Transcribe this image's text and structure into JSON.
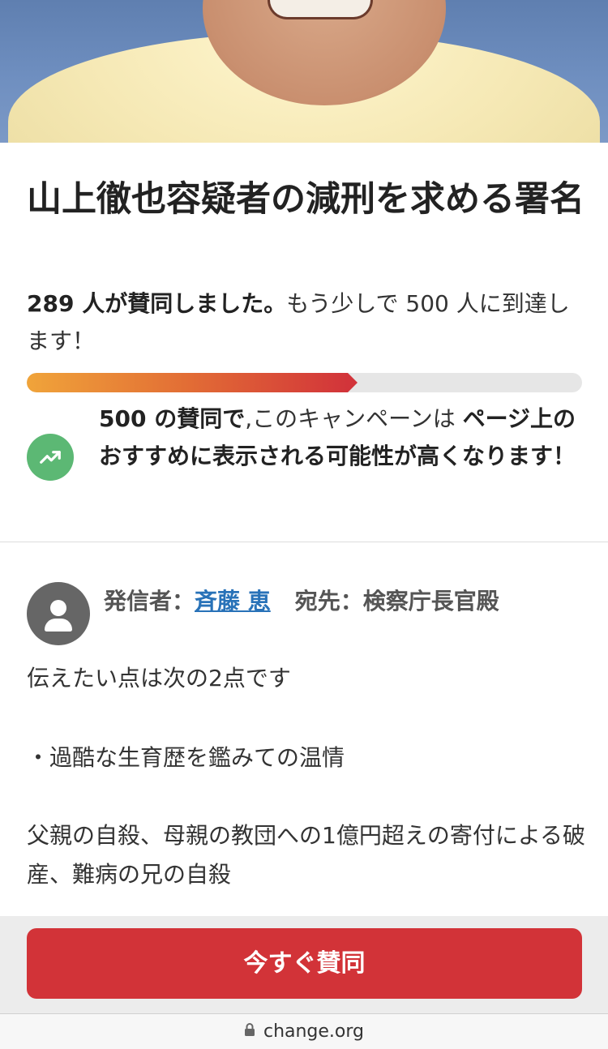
{
  "petition": {
    "title": "山上徹也容疑者の減刑を求める署名",
    "supporters_bold": "289 人が賛同しました。",
    "supporters_rest": "もう少しで 500 人に到達します！",
    "progress_fraction": 0.578,
    "milestone_bold_1": "500 の賛同で",
    "milestone_normal": ",このキャンペーンは ",
    "milestone_bold_2": "ページ上のおすすめに表示される可能性が高くなります！"
  },
  "meta": {
    "author_label": "発信者：",
    "author_name": "斉藤 恵",
    "recipient_label": "宛先：",
    "recipient_name": "検察庁長官殿"
  },
  "body": {
    "p1": "伝えたい点は次の2点です",
    "p2": "・過酷な生育歴を鑑みての温情",
    "p3": "父親の自殺、母親の教団への1億円超えの寄付による破産、難病の兄の自殺"
  },
  "cta": {
    "label": "今すぐ賛同"
  },
  "browser": {
    "url": "change.org"
  },
  "colors": {
    "cta": "#d23338",
    "progress_start": "#f0a43a",
    "progress_end": "#d2343a",
    "trend_icon": "#5cb874",
    "author_link": "#2872b8"
  },
  "icons": {
    "trend": "trending-up-icon",
    "avatar": "user-avatar-icon",
    "lock": "lock-icon"
  }
}
